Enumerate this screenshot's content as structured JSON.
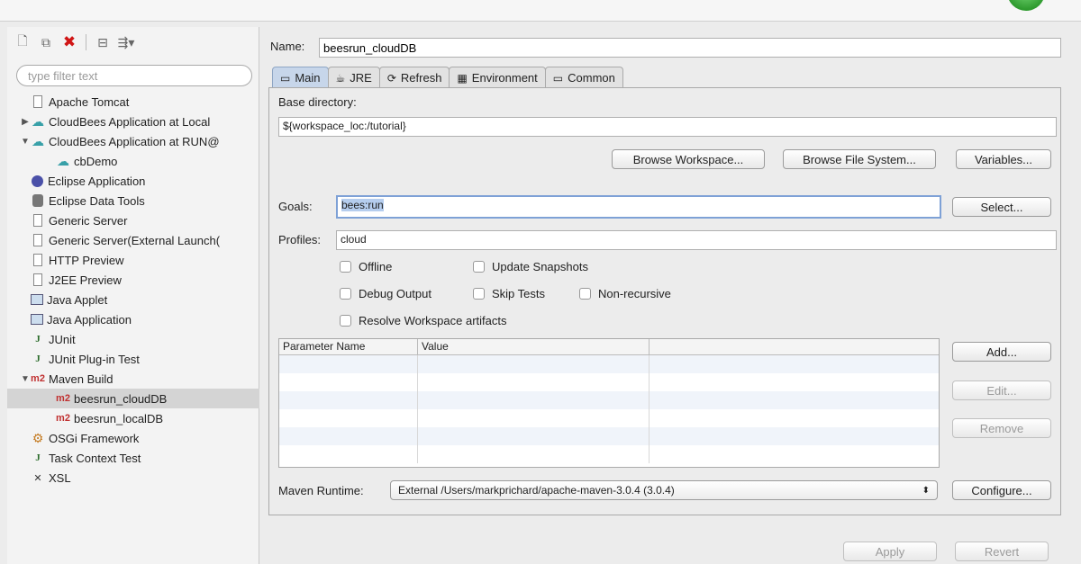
{
  "left": {
    "filter_placeholder": "type filter text",
    "tree": [
      {
        "label": "Apache Tomcat",
        "icon": "doc",
        "indent": 0,
        "twisty": ""
      },
      {
        "label": "CloudBees Application at Local",
        "icon": "cloud",
        "indent": 0,
        "twisty": "▶"
      },
      {
        "label": "CloudBees Application at RUN@",
        "icon": "cloud",
        "indent": 0,
        "twisty": "▼"
      },
      {
        "label": "cbDemo",
        "icon": "cloud",
        "indent": 1,
        "twisty": ""
      },
      {
        "label": "Eclipse Application",
        "icon": "globe",
        "indent": 0,
        "twisty": ""
      },
      {
        "label": "Eclipse Data Tools",
        "icon": "db",
        "indent": 0,
        "twisty": ""
      },
      {
        "label": "Generic Server",
        "icon": "doc",
        "indent": 0,
        "twisty": ""
      },
      {
        "label": "Generic Server(External Launch(",
        "icon": "doc",
        "indent": 0,
        "twisty": ""
      },
      {
        "label": "HTTP Preview",
        "icon": "doc",
        "indent": 0,
        "twisty": ""
      },
      {
        "label": "J2EE Preview",
        "icon": "doc",
        "indent": 0,
        "twisty": ""
      },
      {
        "label": "Java Applet",
        "icon": "applet",
        "indent": 0,
        "twisty": ""
      },
      {
        "label": "Java Application",
        "icon": "applet",
        "indent": 0,
        "twisty": ""
      },
      {
        "label": "JUnit",
        "icon": "j",
        "indent": 0,
        "twisty": ""
      },
      {
        "label": "JUnit Plug-in Test",
        "icon": "j",
        "indent": 0,
        "twisty": ""
      },
      {
        "label": "Maven Build",
        "icon": "m2",
        "indent": 0,
        "twisty": "▼"
      },
      {
        "label": "beesrun_cloudDB",
        "icon": "m2",
        "indent": 1,
        "twisty": "",
        "selected": true
      },
      {
        "label": "beesrun_localDB",
        "icon": "m2",
        "indent": 1,
        "twisty": ""
      },
      {
        "label": "OSGi Framework",
        "icon": "osgi",
        "indent": 0,
        "twisty": ""
      },
      {
        "label": "Task Context Test",
        "icon": "j",
        "indent": 0,
        "twisty": ""
      },
      {
        "label": "XSL",
        "icon": "x",
        "indent": 0,
        "twisty": ""
      }
    ]
  },
  "config": {
    "name_label": "Name:",
    "name_value": "beesrun_cloudDB",
    "tabs": [
      {
        "label": "Main",
        "icon": "main-tab-icon",
        "glyph": "▭"
      },
      {
        "label": "JRE",
        "icon": "jre-icon",
        "glyph": "☕"
      },
      {
        "label": "Refresh",
        "icon": "refresh-icon",
        "glyph": "⟳"
      },
      {
        "label": "Environment",
        "icon": "environment-icon",
        "glyph": "▦"
      },
      {
        "label": "Common",
        "icon": "common-icon",
        "glyph": "▭"
      }
    ],
    "base_dir_label": "Base directory:",
    "base_dir_value": "${workspace_loc:/tutorial}",
    "browse_workspace": "Browse Workspace...",
    "browse_fs": "Browse File System...",
    "variables": "Variables...",
    "goals_label": "Goals:",
    "goals_value": "bees:run",
    "select": "Select...",
    "profiles_label": "Profiles:",
    "profiles_value": "cloud",
    "checkboxes": {
      "offline": "Offline",
      "update_snapshots": "Update Snapshots",
      "debug_output": "Debug Output",
      "skip_tests": "Skip Tests",
      "non_recursive": "Non-recursive",
      "resolve_workspace": "Resolve Workspace artifacts"
    },
    "table": {
      "col_name": "Parameter Name",
      "col_value": "Value"
    },
    "add": "Add...",
    "edit": "Edit...",
    "remove": "Remove",
    "runtime_label": "Maven Runtime:",
    "runtime_value": "External /Users/markprichard/apache-maven-3.0.4 (3.0.4)",
    "configure": "Configure...",
    "apply": "Apply",
    "revert": "Revert"
  }
}
